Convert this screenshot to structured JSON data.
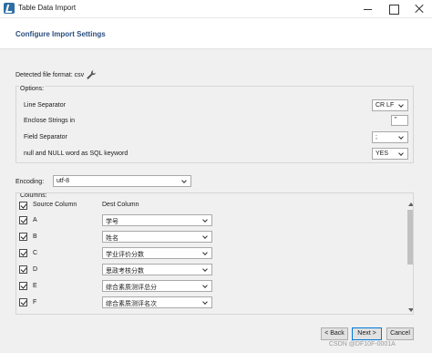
{
  "window": {
    "title": "Table Data Import"
  },
  "page": {
    "title": "Configure Import Settings"
  },
  "file_format": {
    "label": "Detected file format: csv",
    "icon": "wrench-icon"
  },
  "options": {
    "group_label": "Options:",
    "line_separator": {
      "label": "Line Separator",
      "value": "CR LF"
    },
    "enclose_strings": {
      "label": "Enclose Strings in",
      "value": "\""
    },
    "field_separator": {
      "label": "Field Separator",
      "value": ";"
    },
    "null_keyword": {
      "label": "null and NULL word as SQL keyword",
      "value": "YES"
    }
  },
  "encoding": {
    "label": "Encoding:",
    "value": "utf-8"
  },
  "columns": {
    "group_label": "Columns:",
    "header_source": "Source Column",
    "header_dest": "Dest Column",
    "rows": [
      {
        "source": "A",
        "dest": "学号",
        "checked": true
      },
      {
        "source": "B",
        "dest": "姓名",
        "checked": true
      },
      {
        "source": "C",
        "dest": "学业评价分数",
        "checked": true
      },
      {
        "source": "D",
        "dest": "思政考核分数",
        "checked": true
      },
      {
        "source": "E",
        "dest": "综合素质测评总分",
        "checked": true
      },
      {
        "source": "F",
        "dest": "综合素质测评名次",
        "checked": true
      }
    ]
  },
  "buttons": {
    "back": "< Back",
    "next": "Next >",
    "cancel": "Cancel"
  },
  "watermark": "CSDN @DF10F-0001A",
  "colors": {
    "title_blue": "#2a4d80",
    "panel_bg": "#f0f0f0",
    "focus_border": "#0078d7"
  }
}
